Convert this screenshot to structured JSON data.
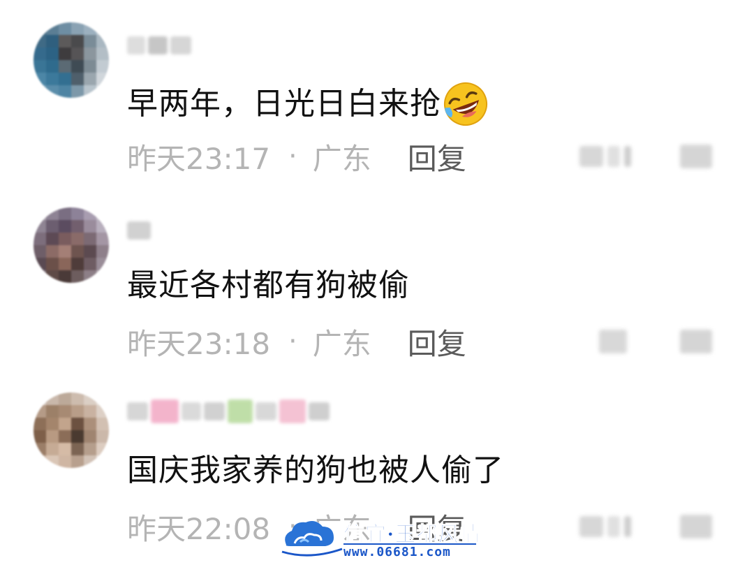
{
  "comments": [
    {
      "content": "早两年，日光日白来抢",
      "emoji": "rolling-on-floor-laughing-emoji",
      "time": "昨天23:17",
      "separator": "·",
      "location": "广东",
      "reply_label": "回复"
    },
    {
      "content": "最近各村都有狗被偷",
      "time": "昨天23:18",
      "separator": "·",
      "location": "广东",
      "reply_label": "回复"
    },
    {
      "content": "国庆我家养的狗也被人偷了",
      "time": "昨天22:08",
      "separator": "·",
      "location": "广东",
      "reply_label": "回复"
    }
  ],
  "watermark": {
    "title": "信宜·玉都风情",
    "url": "www.06681.com"
  },
  "colors": {
    "content_text": "#111111",
    "meta_text": "#b4b4b4",
    "reply_text": "#5a5a5a",
    "watermark_blue": "#1a56c8"
  }
}
